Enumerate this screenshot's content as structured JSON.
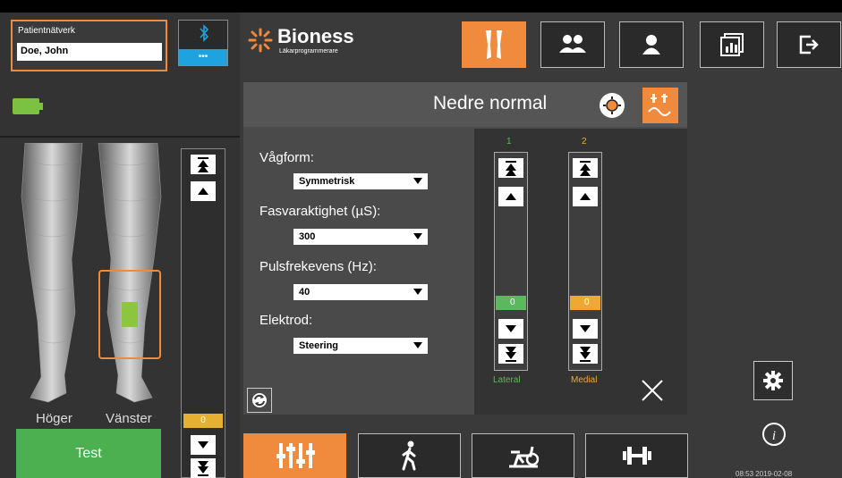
{
  "patient": {
    "label": "Patientnätverk",
    "name": "Doe, John"
  },
  "device": {
    "dots": "•••"
  },
  "brand": {
    "name": "Bioness",
    "sub": "Läkarprogrammerare"
  },
  "legs": {
    "right_label": "Höger",
    "left_label": "Vänster"
  },
  "left_slider": {
    "value": "0"
  },
  "test_label": "Test",
  "panel": {
    "title": "Nedre normal"
  },
  "fields": [
    {
      "label": "Vågform:",
      "value": "Symmetrisk"
    },
    {
      "label": "Fasvaraktighet (µS):",
      "value": "300"
    },
    {
      "label": "Pulsfrekevens (Hz):",
      "value": "40"
    },
    {
      "label": "Elektrod:",
      "value": "Steering"
    }
  ],
  "channels": [
    {
      "number": "1",
      "value": "0",
      "name": "Lateral",
      "color": "#5cb85c"
    },
    {
      "number": "2",
      "value": "0",
      "name": "Medial",
      "color": "#f0a830"
    }
  ],
  "status": {
    "datetime": "08:53 2019-02-08"
  },
  "colors": {
    "accent": "#f08a3c",
    "green": "#4caf50",
    "blue": "#1fa3e0"
  }
}
